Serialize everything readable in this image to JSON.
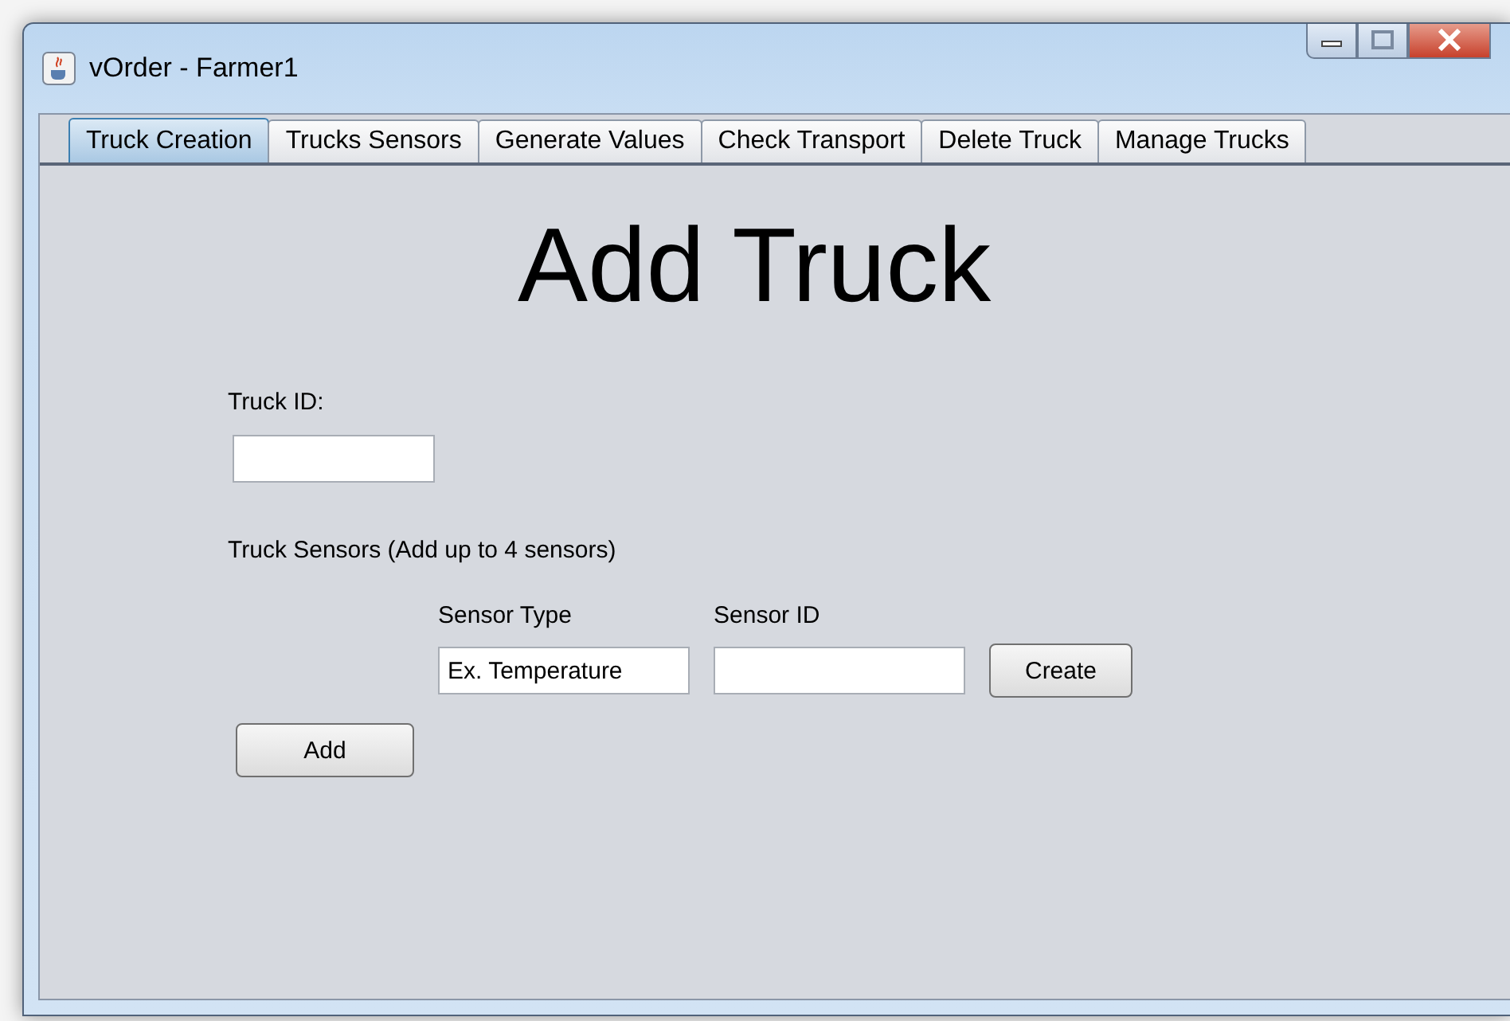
{
  "window": {
    "title": "vOrder - Farmer1"
  },
  "tabs": [
    {
      "label": "Truck Creation",
      "selected": true
    },
    {
      "label": "Trucks Sensors",
      "selected": false
    },
    {
      "label": "Generate Values",
      "selected": false
    },
    {
      "label": "Check Transport",
      "selected": false
    },
    {
      "label": "Delete Truck",
      "selected": false
    },
    {
      "label": "Manage Trucks",
      "selected": false
    }
  ],
  "heading": "Add Truck",
  "truck_id": {
    "label": "Truck ID:"
  },
  "sensors": {
    "label": "Truck Sensors (Add up to 4 sensors)",
    "type_label": "Sensor Type",
    "id_label": "Sensor ID",
    "type_value": "Ex. Temperature",
    "create_button": "Create"
  },
  "add_button": "Add"
}
